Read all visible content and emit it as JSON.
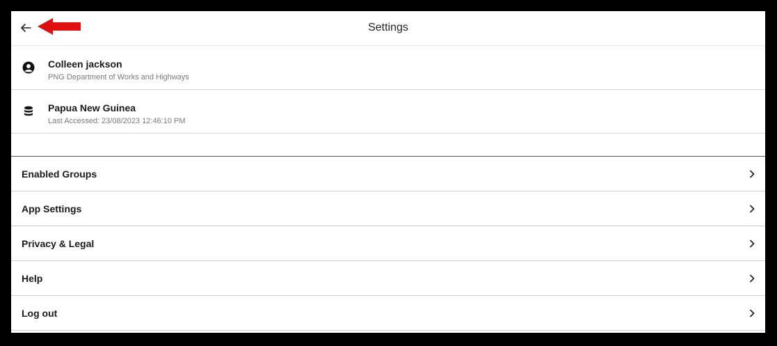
{
  "header": {
    "title": "Settings",
    "back_icon": "arrow-left-icon",
    "annotation_color": "#e01010"
  },
  "accounts": [
    {
      "icon": "account-circle-icon",
      "title": "Colleen jackson",
      "subtitle": "PNG Department of Works and Highways"
    },
    {
      "icon": "database-icon",
      "title": "Papua New Guinea",
      "subtitle": "Last Accessed: 23/08/2023 12:46:10 PM"
    }
  ],
  "menu": [
    {
      "label": "Enabled Groups",
      "icon": "chevron-right-icon"
    },
    {
      "label": "App Settings",
      "icon": "chevron-right-icon"
    },
    {
      "label": "Privacy & Legal",
      "icon": "chevron-right-icon"
    },
    {
      "label": "Help",
      "icon": "chevron-right-icon"
    },
    {
      "label": "Log out",
      "icon": "chevron-right-icon"
    }
  ]
}
